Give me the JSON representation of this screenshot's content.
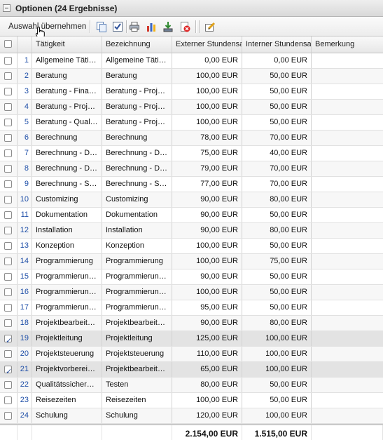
{
  "title": "Optionen (24 Ergebnisse)",
  "toolbar": {
    "apply_label": "Auswahl übernehmen",
    "icons": [
      "copy-icon",
      "check-all-icon",
      "print-icon",
      "chart-icon",
      "download-icon",
      "delete-icon",
      "edit-icon"
    ]
  },
  "columns": [
    "",
    "",
    "Tätigkeit",
    "Bezeichnung",
    "Externer Stundensa",
    "Interner Stundensa",
    "Bemerkung"
  ],
  "rows": [
    {
      "n": "1",
      "checked": false,
      "taetigkeit": "Allgemeine Täti…",
      "bezeichnung": "Allgemeine Täti…",
      "extern": "0,00 EUR",
      "intern": "0,00 EUR",
      "bemerkung": ""
    },
    {
      "n": "2",
      "checked": false,
      "taetigkeit": "Beratung",
      "bezeichnung": "Beratung",
      "extern": "100,00 EUR",
      "intern": "50,00 EUR",
      "bemerkung": ""
    },
    {
      "n": "3",
      "checked": false,
      "taetigkeit": "Beratung - Fina…",
      "bezeichnung": "Beratung - Proj…",
      "extern": "100,00 EUR",
      "intern": "50,00 EUR",
      "bemerkung": ""
    },
    {
      "n": "4",
      "checked": false,
      "taetigkeit": "Beratung - Proj…",
      "bezeichnung": "Beratung - Proj…",
      "extern": "100,00 EUR",
      "intern": "50,00 EUR",
      "bemerkung": ""
    },
    {
      "n": "5",
      "checked": false,
      "taetigkeit": "Beratung - Qual…",
      "bezeichnung": "Beratung - Proj…",
      "extern": "100,00 EUR",
      "intern": "50,00 EUR",
      "bemerkung": ""
    },
    {
      "n": "6",
      "checked": false,
      "taetigkeit": "Berechnung",
      "bezeichnung": "Berechnung",
      "extern": "78,00 EUR",
      "intern": "70,00 EUR",
      "bemerkung": ""
    },
    {
      "n": "7",
      "checked": false,
      "taetigkeit": "Berechnung - D…",
      "bezeichnung": "Berechnung - D…",
      "extern": "75,00 EUR",
      "intern": "40,00 EUR",
      "bemerkung": ""
    },
    {
      "n": "8",
      "checked": false,
      "taetigkeit": "Berechnung - D…",
      "bezeichnung": "Berechnung - D…",
      "extern": "79,00 EUR",
      "intern": "70,00 EUR",
      "bemerkung": ""
    },
    {
      "n": "9",
      "checked": false,
      "taetigkeit": "Berechnung - St…",
      "bezeichnung": "Berechnung - St…",
      "extern": "77,00 EUR",
      "intern": "70,00 EUR",
      "bemerkung": ""
    },
    {
      "n": "10",
      "checked": false,
      "taetigkeit": "Customizing",
      "bezeichnung": "Customizing",
      "extern": "90,00 EUR",
      "intern": "80,00 EUR",
      "bemerkung": ""
    },
    {
      "n": "11",
      "checked": false,
      "taetigkeit": "Dokumentation",
      "bezeichnung": "Dokumentation",
      "extern": "90,00 EUR",
      "intern": "50,00 EUR",
      "bemerkung": ""
    },
    {
      "n": "12",
      "checked": false,
      "taetigkeit": "Installation",
      "bezeichnung": "Installation",
      "extern": "90,00 EUR",
      "intern": "80,00 EUR",
      "bemerkung": ""
    },
    {
      "n": "13",
      "checked": false,
      "taetigkeit": "Konzeption",
      "bezeichnung": "Konzeption",
      "extern": "100,00 EUR",
      "intern": "50,00 EUR",
      "bemerkung": ""
    },
    {
      "n": "14",
      "checked": false,
      "taetigkeit": "Programmierung",
      "bezeichnung": "Programmierung",
      "extern": "100,00 EUR",
      "intern": "75,00 EUR",
      "bemerkung": ""
    },
    {
      "n": "15",
      "checked": false,
      "taetigkeit": "Programmierun…",
      "bezeichnung": "Programmierun…",
      "extern": "90,00 EUR",
      "intern": "50,00 EUR",
      "bemerkung": ""
    },
    {
      "n": "16",
      "checked": false,
      "taetigkeit": "Programmierun…",
      "bezeichnung": "Programmierun…",
      "extern": "100,00 EUR",
      "intern": "50,00 EUR",
      "bemerkung": ""
    },
    {
      "n": "17",
      "checked": false,
      "taetigkeit": "Programmierun…",
      "bezeichnung": "Programmierun…",
      "extern": "95,00 EUR",
      "intern": "50,00 EUR",
      "bemerkung": ""
    },
    {
      "n": "18",
      "checked": false,
      "taetigkeit": "Projektbearbeit…",
      "bezeichnung": "Projektbearbeit…",
      "extern": "90,00 EUR",
      "intern": "80,00 EUR",
      "bemerkung": ""
    },
    {
      "n": "19",
      "checked": true,
      "taetigkeit": "Projektleitung",
      "bezeichnung": "Projektleitung",
      "extern": "125,00 EUR",
      "intern": "100,00 EUR",
      "bemerkung": ""
    },
    {
      "n": "20",
      "checked": false,
      "taetigkeit": "Projektsteuerung",
      "bezeichnung": "Projektsteuerung",
      "extern": "110,00 EUR",
      "intern": "100,00 EUR",
      "bemerkung": ""
    },
    {
      "n": "21",
      "checked": true,
      "taetigkeit": "Projektvorberei…",
      "bezeichnung": "Projektbearbeit…",
      "extern": "65,00 EUR",
      "intern": "100,00 EUR",
      "bemerkung": ""
    },
    {
      "n": "22",
      "checked": false,
      "taetigkeit": "Qualitätssicher…",
      "bezeichnung": "Testen",
      "extern": "80,00 EUR",
      "intern": "50,00 EUR",
      "bemerkung": ""
    },
    {
      "n": "23",
      "checked": false,
      "taetigkeit": "Reisezeiten",
      "bezeichnung": "Reisezeiten",
      "extern": "100,00 EUR",
      "intern": "50,00 EUR",
      "bemerkung": ""
    },
    {
      "n": "24",
      "checked": false,
      "taetigkeit": "Schulung",
      "bezeichnung": "Schulung",
      "extern": "120,00 EUR",
      "intern": "100,00 EUR",
      "bemerkung": ""
    }
  ],
  "totals": {
    "extern": "2.154,00 EUR",
    "intern": "1.515,00 EUR"
  },
  "colors": {
    "accent": "#1f4fa8",
    "selected_row": "#e3e3e3"
  }
}
